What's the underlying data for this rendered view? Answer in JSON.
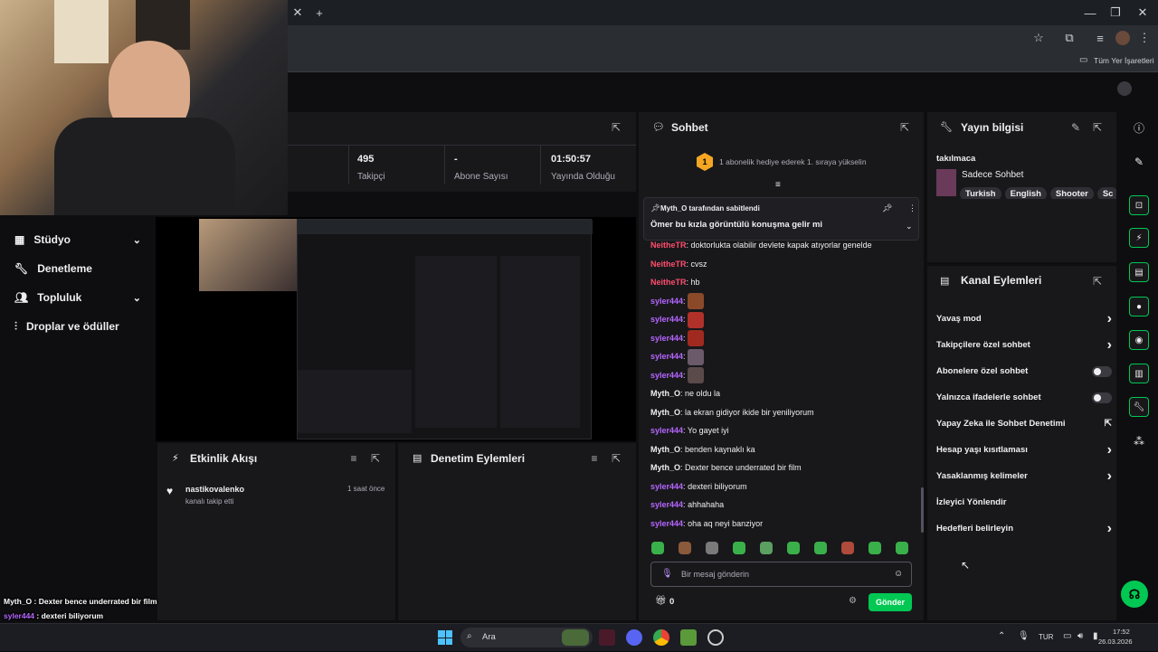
{
  "browser": {
    "bookmarks_label": "Tüm Yer İşaretleri"
  },
  "sidebar": {
    "items": [
      {
        "label": "Stüdyo",
        "has_chevron": true
      },
      {
        "label": "Denetleme",
        "has_chevron": false
      },
      {
        "label": "Topluluk",
        "has_chevron": true
      },
      {
        "label": "Droplar ve ödüller",
        "has_chevron": false
      }
    ]
  },
  "stats": [
    {
      "value": "495",
      "label": "Takipçi"
    },
    {
      "value": "-",
      "label": "Abone Sayısı"
    },
    {
      "value": "01:50:57",
      "label": "Yayında Olduğu"
    }
  ],
  "event_feed": {
    "title": "Etkinlik Akışı",
    "events": [
      {
        "user": "nastikovalenko",
        "action": "kanalı takip etti",
        "time": "1 saat önce"
      }
    ]
  },
  "mod_actions": {
    "title": "Denetim Eylemleri"
  },
  "chat": {
    "title": "Sohbet",
    "hype_text": "1 abonelik hediye ederek 1. sıraya yükselin",
    "hype_badge": "1",
    "pinned_by": "Myth_O tarafından sabitlendi",
    "pinned_msg": "Ömer bu kızla görüntülü konuşma gelir mi",
    "messages": [
      {
        "user": "NeitheTR",
        "color": "#ff4d6d",
        "text": "doktorlukta olabilir devlete kapak atıyorlar genelde",
        "emote": false
      },
      {
        "user": "NeitheTR",
        "color": "#ff4d6d",
        "text": "cvsz",
        "emote": false
      },
      {
        "user": "NeitheTR",
        "color": "#ff4d6d",
        "text": "hb",
        "emote": false
      },
      {
        "user": "syler444",
        "color": "#b666ff",
        "text": "",
        "emote": true
      },
      {
        "user": "syler444",
        "color": "#b666ff",
        "text": "",
        "emote": true
      },
      {
        "user": "syler444",
        "color": "#b666ff",
        "text": "",
        "emote": true
      },
      {
        "user": "syler444",
        "color": "#b666ff",
        "text": "",
        "emote": true
      },
      {
        "user": "syler444",
        "color": "#b666ff",
        "text": "",
        "emote": true
      },
      {
        "user": "Myth_O",
        "color": "#efeff1",
        "text": "ne oldu la",
        "emote": false
      },
      {
        "user": "Myth_O",
        "color": "#efeff1",
        "text": "la ekran gidiyor ikide bir yeniliyorum",
        "emote": false
      },
      {
        "user": "syler444",
        "color": "#b666ff",
        "text": "Yo gayet iyi",
        "emote": false
      },
      {
        "user": "Myth_O",
        "color": "#efeff1",
        "text": "benden kaynaklı ka",
        "emote": false
      },
      {
        "user": "Myth_O",
        "color": "#efeff1",
        "text": "Dexter bence underrated bir film",
        "emote": false
      },
      {
        "user": "syler444",
        "color": "#b666ff",
        "text": "dexteri biliyorum",
        "emote": false
      },
      {
        "user": "syler444",
        "color": "#b666ff",
        "text": "ahhahaha",
        "emote": false
      },
      {
        "user": "syler444",
        "color": "#b666ff",
        "text": "oha aq neyi banziyor",
        "emote": false
      }
    ],
    "input_placeholder": "Bir mesaj gönderin",
    "points": "0",
    "send_label": "Gönder"
  },
  "stream_info": {
    "title": "Yayın bilgisi",
    "stream_title": "takılmaca",
    "category": "Sadece Sohbet",
    "tags": [
      "Turkish",
      "English",
      "Shooter",
      "Sc"
    ]
  },
  "channel_actions": {
    "title": "Kanal Eylemleri",
    "items": [
      {
        "label": "Yavaş mod",
        "control": "chevron"
      },
      {
        "label": "Takipçilere özel sohbet",
        "control": "chevron"
      },
      {
        "label": "Abonelere özel sohbet",
        "control": "toggle"
      },
      {
        "label": "Yalnızca ifadelerle sohbet",
        "control": "toggle"
      },
      {
        "label": "Yapay Zeka ile Sohbet Denetimi",
        "control": "external"
      },
      {
        "label": "Hesap yaşı kısıtlaması",
        "control": "chevron"
      },
      {
        "label": "Yasaklanmış kelimeler",
        "control": "chevron"
      },
      {
        "label": "İzleyici Yönlendir",
        "control": "none"
      },
      {
        "label": "Hedefleri belirleyin",
        "control": "chevron"
      }
    ]
  },
  "overlay_chat": [
    {
      "user": "Myth_O",
      "text": "Dexter bence underrated bir film",
      "color": "#ffffff"
    },
    {
      "user": "syler444",
      "text": "dexteri biliyorum",
      "color": "#b666ff"
    },
    {
      "user": "syler444",
      "text": "ahhahaha",
      "color": "#b666ff"
    },
    {
      "user": "syler444",
      "text": "oha aq neyi banziyor",
      "color": "#b666ff"
    }
  ],
  "taskbar": {
    "search_label": "Ara",
    "lang": "TUR",
    "time": "17:52",
    "date": "26.03.2026"
  },
  "colors": {
    "accent_green": "#00c853",
    "panel_bg": "#18181b",
    "page_bg": "#0e0e10"
  }
}
